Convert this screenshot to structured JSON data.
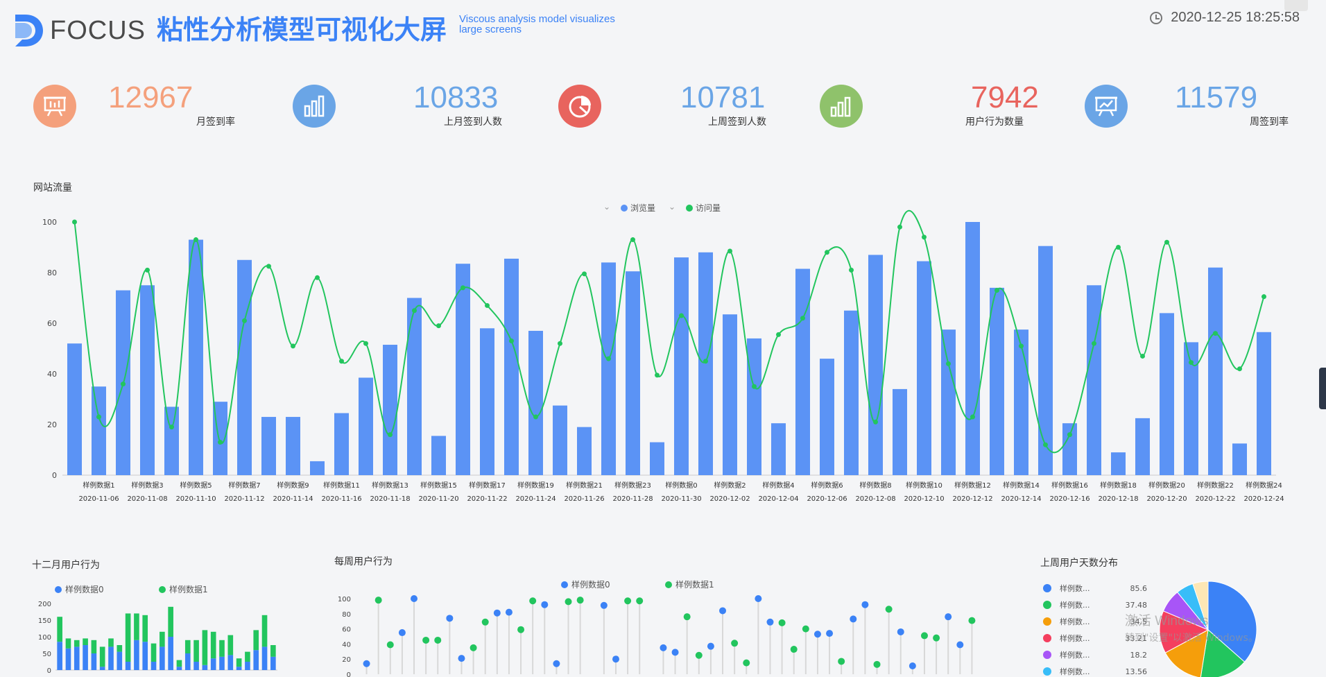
{
  "header": {
    "logo_text": "FOCUS",
    "title": "粘性分析模型可视化大屏",
    "subtitle": "Viscous analysis model visualizes large screens",
    "datetime": "2020-12-25 18:25:58",
    "clock_icon": "clock-icon"
  },
  "kpis": [
    {
      "value": "12967",
      "label": "月签到率",
      "color": "#f4a07c",
      "icon": "presentation-board-icon"
    },
    {
      "value": "10833",
      "label": "上月签到人数",
      "color": "#6aa5e6",
      "icon": "bar-chart-icon"
    },
    {
      "value": "10781",
      "label": "上周签到人数",
      "color": "#e8645e",
      "icon": "pie-chart-icon"
    },
    {
      "value": "7942",
      "label": "用户行为数量",
      "color": "#8fc26b",
      "icon": "bar-chart-icon"
    },
    {
      "value": "11579",
      "label": "周签到率",
      "color": "#6aa5e6",
      "icon": "trend-board-icon"
    }
  ],
  "kpi_value_colors": [
    "#f4a07c",
    "#6aa5e6",
    "#6aa5e6",
    "#e8645e",
    "#6aa5e6"
  ],
  "traffic": {
    "title": "网站流量",
    "legend": [
      {
        "name": "浏览量",
        "color": "#5b93f5"
      },
      {
        "name": "访问量",
        "color": "#22c55e"
      }
    ]
  },
  "chart_data": [
    {
      "type": "bar",
      "title": "网站流量",
      "ylim": [
        0,
        100
      ],
      "yticks": [
        0,
        20,
        40,
        60,
        80,
        100
      ],
      "category_labels": [
        "样例数据1",
        "样例数据3",
        "样例数据5",
        "样例数据7",
        "样例数据9",
        "样例数据11",
        "样例数据13",
        "样例数据15",
        "样例数据17",
        "样例数据19",
        "样例数据21",
        "样例数据23",
        "样例数据0",
        "样例数据2",
        "样例数据4",
        "样例数据6",
        "样例数据8",
        "样例数据10",
        "样例数据12",
        "样例数据14",
        "样例数据16",
        "样例数据18",
        "样例数据20",
        "样例数据22",
        "样例数据24"
      ],
      "date_labels": [
        "2020-11-06",
        "2020-11-08",
        "2020-11-10",
        "2020-11-12",
        "2020-11-14",
        "2020-11-16",
        "2020-11-18",
        "2020-11-20",
        "2020-11-22",
        "2020-11-24",
        "2020-11-26",
        "2020-11-28",
        "2020-11-30",
        "2020-12-02",
        "2020-12-04",
        "2020-12-06",
        "2020-12-08",
        "2020-12-10",
        "2020-12-12",
        "2020-12-14",
        "2020-12-16",
        "2020-12-18",
        "2020-12-20",
        "2020-12-22",
        "2020-12-24"
      ],
      "series": [
        {
          "name": "浏览量",
          "kind": "bar",
          "values": [
            52,
            35,
            73,
            75,
            27,
            93,
            29,
            85,
            23,
            23,
            5.5,
            24.5,
            38.5,
            51.5,
            70,
            15.5,
            83.5,
            58,
            85.5,
            57,
            27.5,
            19,
            84,
            80.5,
            13,
            86,
            88,
            63.5,
            54,
            20.5,
            81.5,
            46,
            65,
            87,
            34,
            84.5,
            57.5,
            100,
            74,
            57.5,
            90.5,
            20.5,
            75,
            9,
            22.5,
            64,
            52.5,
            82,
            12.5,
            56.5
          ]
        },
        {
          "name": "访问量",
          "kind": "line",
          "values": [
            100,
            23,
            36,
            81,
            19,
            93,
            13,
            61,
            82.5,
            51,
            78,
            45,
            52,
            16,
            65,
            59,
            74,
            67,
            53,
            23,
            52,
            79.5,
            46,
            93,
            39.5,
            63,
            45,
            88.5,
            35,
            55.5,
            62,
            88,
            81,
            21,
            98,
            94,
            44,
            23,
            73,
            51,
            12,
            16,
            52,
            90,
            47,
            92,
            44.5,
            56,
            42,
            70.5
          ]
        }
      ]
    },
    {
      "type": "bar",
      "title": "十二月用户行为",
      "stacked": true,
      "ylim": [
        0,
        200
      ],
      "yticks": [
        0,
        50,
        100,
        150,
        200
      ],
      "series": [
        {
          "name": "样例数据0",
          "values": [
            85,
            65,
            70,
            75,
            50,
            10,
            70,
            55,
            25,
            90,
            85,
            25,
            70,
            100,
            10,
            50,
            25,
            15,
            35,
            40,
            45,
            10,
            25,
            60,
            70,
            40
          ]
        },
        {
          "name": "样例数据1",
          "values": [
            75,
            30,
            20,
            20,
            40,
            60,
            25,
            20,
            145,
            80,
            80,
            55,
            45,
            90,
            20,
            40,
            65,
            105,
            80,
            50,
            60,
            25,
            30,
            60,
            95,
            35
          ]
        }
      ]
    },
    {
      "type": "scatter",
      "title": "每周用户行为",
      "ylim": [
        0,
        100
      ],
      "yticks": [
        0,
        20,
        40,
        60,
        80,
        100
      ],
      "series": [
        {
          "name": "样例数据0",
          "points": [
            [
              0,
              14
            ],
            [
              3,
              55
            ],
            [
              4,
              100
            ],
            [
              7,
              74
            ],
            [
              8,
              21
            ],
            [
              11,
              81
            ],
            [
              12,
              82
            ],
            [
              15,
              92
            ],
            [
              16,
              14
            ],
            [
              20,
              91
            ],
            [
              21,
              20
            ],
            [
              25,
              35
            ],
            [
              26,
              29
            ],
            [
              29,
              37
            ],
            [
              30,
              84
            ],
            [
              33,
              100
            ],
            [
              34,
              69
            ],
            [
              38,
              53
            ],
            [
              39,
              54
            ],
            [
              41,
              73
            ],
            [
              42,
              92
            ],
            [
              45,
              56
            ],
            [
              46,
              11
            ],
            [
              49,
              76
            ],
            [
              50,
              39
            ]
          ]
        },
        {
          "name": "样例数据1",
          "points": [
            [
              1,
              98
            ],
            [
              2,
              39
            ],
            [
              5,
              45
            ],
            [
              6,
              45
            ],
            [
              9,
              35
            ],
            [
              10,
              69
            ],
            [
              13,
              59
            ],
            [
              14,
              97
            ],
            [
              17,
              96
            ],
            [
              18,
              98
            ],
            [
              22,
              97
            ],
            [
              23,
              97
            ],
            [
              27,
              76
            ],
            [
              28,
              25
            ],
            [
              31,
              41
            ],
            [
              32,
              15
            ],
            [
              35,
              68
            ],
            [
              36,
              33
            ],
            [
              37,
              60
            ],
            [
              40,
              17
            ],
            [
              43,
              13
            ],
            [
              44,
              86
            ],
            [
              47,
              51
            ],
            [
              48,
              48
            ],
            [
              51,
              71
            ]
          ]
        }
      ]
    },
    {
      "type": "pie",
      "title": "上周用户天数分布",
      "slices": [
        {
          "name": "样例数...",
          "value": 85.6,
          "color": "#3b82f6"
        },
        {
          "name": "样例数...",
          "value": 37.48,
          "color": "#22c55e"
        },
        {
          "name": "样例数...",
          "value": 34.5,
          "color": "#f59e0b"
        },
        {
          "name": "样例数...",
          "value": 33.21,
          "color": "#f43f5e"
        },
        {
          "name": "样例数...",
          "value": 18.2,
          "color": "#a855f7"
        },
        {
          "name": "样例数...",
          "value": 13.56,
          "color": "#38bdf8"
        },
        {
          "name": "",
          "value": 12,
          "color": "#fde7b5"
        }
      ],
      "legend_values": [
        "85.6",
        "37.48",
        "34.5",
        "33.21",
        "18.2",
        "13.56"
      ]
    }
  ],
  "watermark": {
    "line1": "激活 Windows",
    "line2": "转到\"设置\"以激活 Windows。"
  }
}
